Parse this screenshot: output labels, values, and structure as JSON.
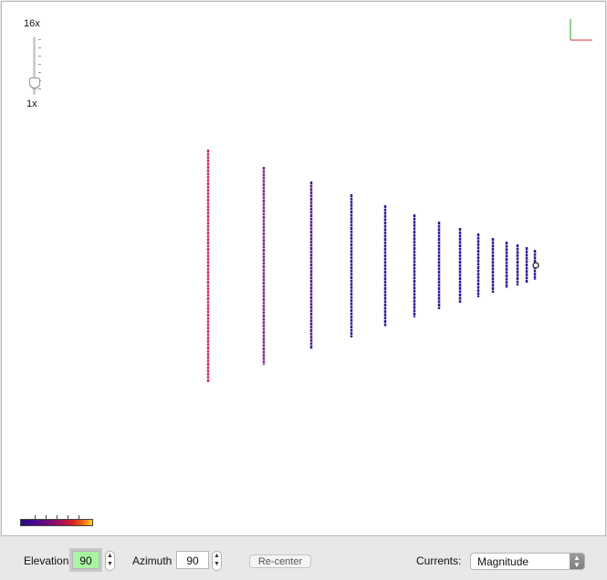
{
  "zoom": {
    "max_label": "16x",
    "min_label": "1x",
    "level_fraction": 0.0
  },
  "antenna": {
    "elements": [
      {
        "color": "#e0503a",
        "center_color": "#f0c020"
      },
      {
        "color": "#c83058",
        "center_color": "#c83058"
      },
      {
        "color": "#782a8a",
        "center_color": "#782a8a"
      },
      {
        "color": "#4a1e90",
        "center_color": "#4a1e90"
      },
      {
        "color": "#3a1c96",
        "center_color": "#3a1c96"
      },
      {
        "color": "#321a98",
        "center_color": "#321a98"
      },
      {
        "color": "#2e1a98",
        "center_color": "#2e1a98"
      },
      {
        "color": "#2c1a98",
        "center_color": "#2c1a98"
      },
      {
        "color": "#2c1a98",
        "center_color": "#2c1a98"
      },
      {
        "color": "#2c1a98",
        "center_color": "#2c1a98"
      },
      {
        "color": "#2c1a98",
        "center_color": "#2c1a98"
      },
      {
        "color": "#2c1a98",
        "center_color": "#2c1a98"
      },
      {
        "color": "#2c1a98",
        "center_color": "#2c1a98"
      },
      {
        "color": "#2c1a98",
        "center_color": "#2c1a98"
      },
      {
        "color": "#2c1a98",
        "center_color": "#2c1a98"
      }
    ],
    "feed_point_icon": "circle-marker-icon",
    "axes_icon": "axes-gizmo-icon",
    "axis_colors": {
      "x": "#e03030",
      "y": "#20a020"
    }
  },
  "colorbar": {
    "icon": "colorbar-legend-icon"
  },
  "toolbar": {
    "elevation_label": "Elevation",
    "elevation_value": "90",
    "azimuth_label": "Azimuth",
    "azimuth_value": "90",
    "recenter_label": "Re-center",
    "currents_label": "Currents:",
    "currents_value": "Magnitude"
  }
}
